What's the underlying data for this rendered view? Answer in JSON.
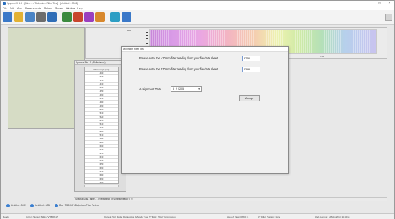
{
  "window": {
    "title": "SpyderXX 6.0 - [Bio / ... / Didymium Filter Test] - [Untitled - 0002]",
    "controls": [
      "–",
      "□",
      "×"
    ]
  },
  "menu": [
    "File",
    "Edit",
    "View",
    "Measurements",
    "Options",
    "Sensor",
    "Window",
    "Help"
  ],
  "toolbar": {
    "icons": [
      {
        "name": "new-icon",
        "color": "#3a78c8"
      },
      {
        "name": "open-icon",
        "color": "#e2b134"
      },
      {
        "name": "save-icon",
        "color": "#4a84c6"
      },
      {
        "name": "print-icon",
        "color": "#6c6c6c"
      },
      {
        "name": "disk-icon",
        "color": "#2f6db6"
      },
      {
        "name": "table-icon",
        "color": "#3b8a3f"
      },
      {
        "name": "chart-icon",
        "color": "#c8452e"
      },
      {
        "name": "spectrum-icon",
        "color": "#9a3fbf"
      },
      {
        "name": "color-icon",
        "color": "#d8882d"
      },
      {
        "name": "settings-icon",
        "color": "#2d9ec4"
      },
      {
        "name": "help-icon",
        "color": "#3a78c8"
      }
    ]
  },
  "spectral_plot": {
    "y_tick": "100",
    "x_labels": [
      "700"
    ]
  },
  "plot_panel": {
    "title": "Spectral Plot - 1 (Reflectance)",
    "column_header": "Wavelength (nm)",
    "wavelengths": [
      "400",
      "410",
      "420",
      "430",
      "440",
      "450",
      "460",
      "470",
      "480",
      "490",
      "500",
      "510",
      "520",
      "530",
      "540",
      "550",
      "560",
      "570",
      "580",
      "590",
      "600",
      "610",
      "620",
      "630",
      "640",
      "650",
      "660",
      "670",
      "680",
      "690",
      "700"
    ]
  },
  "data_table_bar": "Spectral Data Table - 1 (Reflectance (R)/Transmittance (T))",
  "tabs": [
    {
      "label": "Untitled - 0001"
    },
    {
      "label": "Untitled - 0002"
    },
    {
      "label": "Bio \\ TSB110 \\ Didymium Filter Test.pd"
    }
  ],
  "status": {
    "ready": "Ready",
    "sensor": "Current Sensor: Nikka *V7B0811P",
    "mode": "Current Skill Mode: Diagnostics Te  Mode Type: TTRAN - Total Transmission",
    "area": "Area of View: 0.350 in",
    "filter": "UV Filter Position: None",
    "date": "Web Games : 12 May 2018 19:40:14"
  },
  "dialog": {
    "title": "Didymium Filter Test",
    "prompt_430": "Please enter the 430 nm filter reading from your file data sheet",
    "value_430": "37.56",
    "prompt_570": "Please enter the 570 nm filter reading from your file data sheet",
    "value_570": "23.95",
    "assignment_label": "Assignment Date :",
    "assignment_date": "5 / 9 /2008",
    "accept_label": "Accept"
  }
}
